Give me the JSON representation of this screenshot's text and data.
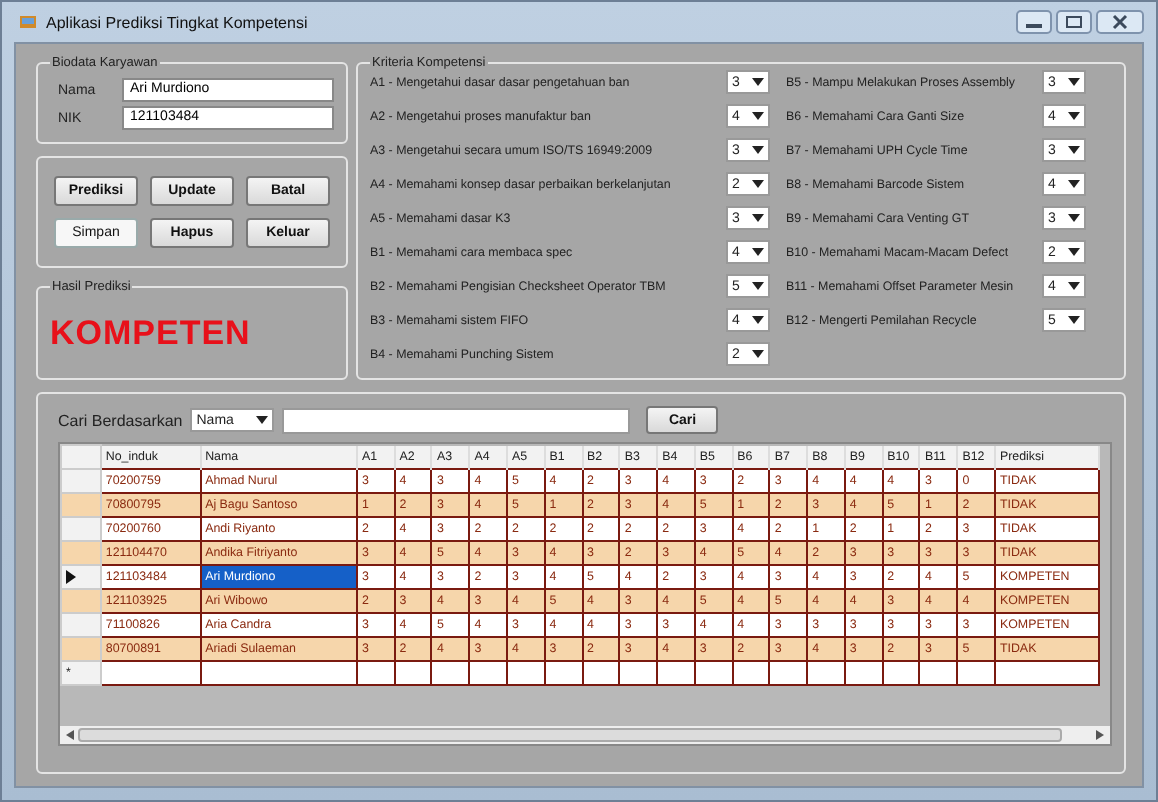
{
  "window": {
    "title": "Aplikasi Prediksi Tingkat Kompetensi"
  },
  "biodata": {
    "title": "Biodata Karyawan",
    "fields": [
      {
        "label": "Nama",
        "value": "Ari Murdiono"
      },
      {
        "label": "NIK",
        "value": "121103484"
      }
    ]
  },
  "buttons": [
    {
      "label": "Prediksi",
      "focused": false
    },
    {
      "label": "Update",
      "focused": false
    },
    {
      "label": "Batal",
      "focused": false
    },
    {
      "label": "Simpan",
      "focused": true
    },
    {
      "label": "Hapus",
      "focused": false
    },
    {
      "label": "Keluar",
      "focused": false
    }
  ],
  "result": {
    "title": "Hasil Prediksi",
    "value": "KOMPETEN"
  },
  "criteria": {
    "title": "Kriteria Kompetensi",
    "columns": [
      [
        {
          "label": "A1 - Mengetahui dasar dasar pengetahuan ban",
          "value": "3"
        },
        {
          "label": "A2 - Mengetahui proses manufaktur ban",
          "value": "4"
        },
        {
          "label": "A3 - Mengetahui secara umum ISO/TS 16949:2009",
          "value": "3"
        },
        {
          "label": "A4 - Memahami konsep dasar perbaikan berkelanjutan",
          "value": "2"
        },
        {
          "label": "A5 - Memahami dasar K3",
          "value": "3"
        },
        {
          "label": "B1 - Memahami cara membaca spec",
          "value": "4"
        },
        {
          "label": "B2 - Memahami Pengisian Checksheet Operator TBM",
          "value": "5"
        },
        {
          "label": "B3 - Memahami sistem FIFO",
          "value": "4"
        },
        {
          "label": "B4 - Memahami Punching Sistem",
          "value": "2"
        }
      ],
      [
        {
          "label": "B5 - Mampu Melakukan Proses Assembly",
          "value": "3"
        },
        {
          "label": "B6 - Memahami Cara Ganti Size",
          "value": "4"
        },
        {
          "label": "B7 - Memahami UPH  Cycle Time",
          "value": "3"
        },
        {
          "label": "B8 - Memahami Barcode Sistem",
          "value": "4"
        },
        {
          "label": "B9 - Memahami Cara Venting GT",
          "value": "3"
        },
        {
          "label": "B10 - Memahami Macam-Macam Defect",
          "value": "2"
        },
        {
          "label": "B11 - Memahami Offset Parameter Mesin",
          "value": "4"
        },
        {
          "label": "B12 - Mengerti Pemilahan Recycle",
          "value": "5"
        }
      ]
    ]
  },
  "search": {
    "label": "Cari Berdasarkan",
    "field": "Nama",
    "button": "Cari"
  },
  "table": {
    "columns": [
      "No_induk",
      "Nama",
      "A1",
      "A2",
      "A3",
      "A4",
      "A5",
      "B1",
      "B2",
      "B3",
      "B4",
      "B5",
      "B6",
      "B7",
      "B8",
      "B9",
      "B10",
      "B11",
      "B12",
      "Prediksi"
    ],
    "rows": [
      {
        "current": false,
        "cells": [
          "70200759",
          "Ahmad Nurul",
          "3",
          "4",
          "3",
          "4",
          "5",
          "4",
          "2",
          "3",
          "4",
          "3",
          "2",
          "3",
          "4",
          "4",
          "4",
          "3",
          "0",
          "TIDAK"
        ]
      },
      {
        "current": false,
        "cells": [
          "70800795",
          "Aj Bagu Santoso",
          "1",
          "2",
          "3",
          "4",
          "5",
          "1",
          "2",
          "3",
          "4",
          "5",
          "1",
          "2",
          "3",
          "4",
          "5",
          "1",
          "2",
          "TIDAK"
        ]
      },
      {
        "current": false,
        "cells": [
          "70200760",
          "Andi Riyanto",
          "2",
          "4",
          "3",
          "2",
          "2",
          "2",
          "2",
          "2",
          "2",
          "3",
          "4",
          "2",
          "1",
          "2",
          "1",
          "2",
          "3",
          "TIDAK"
        ]
      },
      {
        "current": false,
        "cells": [
          "121104470",
          "Andika Fitriyanto",
          "3",
          "4",
          "5",
          "4",
          "3",
          "4",
          "3",
          "2",
          "3",
          "4",
          "5",
          "4",
          "2",
          "3",
          "3",
          "3",
          "3",
          "TIDAK"
        ]
      },
      {
        "current": true,
        "cells": [
          "121103484",
          "Ari Murdiono",
          "3",
          "4",
          "3",
          "2",
          "3",
          "4",
          "5",
          "4",
          "2",
          "3",
          "4",
          "3",
          "4",
          "3",
          "2",
          "4",
          "5",
          "KOMPETEN"
        ]
      },
      {
        "current": false,
        "cells": [
          "121103925",
          "Ari Wibowo",
          "2",
          "3",
          "4",
          "3",
          "4",
          "5",
          "4",
          "3",
          "4",
          "5",
          "4",
          "5",
          "4",
          "4",
          "3",
          "4",
          "4",
          "KOMPETEN"
        ]
      },
      {
        "current": false,
        "cells": [
          "71100826",
          "Aria Candra",
          "3",
          "4",
          "5",
          "4",
          "3",
          "4",
          "4",
          "3",
          "3",
          "4",
          "4",
          "3",
          "3",
          "3",
          "3",
          "3",
          "3",
          "KOMPETEN"
        ]
      },
      {
        "current": false,
        "cells": [
          "80700891",
          "Ariadi Sulaeman",
          "3",
          "2",
          "4",
          "3",
          "4",
          "3",
          "2",
          "3",
          "4",
          "3",
          "2",
          "3",
          "4",
          "3",
          "2",
          "3",
          "5",
          "TIDAK"
        ]
      }
    ],
    "new_row_marker": "*"
  }
}
